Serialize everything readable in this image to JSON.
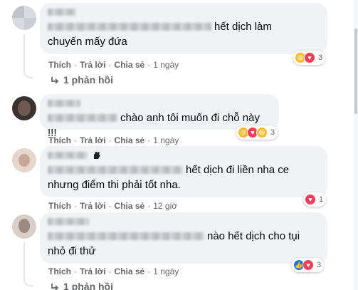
{
  "comments": [
    {
      "text_visible": "hết dịch làm",
      "text_line2": "chuyến mấy đứa",
      "actions": {
        "like": "Thích",
        "reply": "Trả lời",
        "share": "Chia sẻ",
        "time": "1 ngày"
      },
      "reactions": [
        "haha-icon",
        "love-icon"
      ],
      "reaction_count": "3",
      "replies_label": "1 phản hồi"
    },
    {
      "text_visible": "chào anh tôi muốn đi chỗ này !!!",
      "actions": {
        "like": "Thích",
        "reply": "Trả lời",
        "share": "Chia sẻ",
        "time": "1 ngày"
      },
      "reactions": [
        "wow-icon",
        "love-icon",
        "haha-icon"
      ],
      "reaction_count": "3"
    },
    {
      "text_visible": "hết dịch đi liền nha ce",
      "text_line2": "nhưng điểm thi phải tốt nha.",
      "actions": {
        "like": "Thích",
        "reply": "Trả lời",
        "share": "Chia sẻ",
        "time": "12 giờ"
      },
      "reactions": [
        "love-icon"
      ],
      "reaction_count": "1"
    },
    {
      "text_visible": "nào hết dịch cho tụi",
      "text_line2": "nhỏ đi thử",
      "actions": {
        "like": "Thích",
        "reply": "Trả lời",
        "share": "Chia sẻ",
        "time": "1 ngày"
      },
      "reactions": [
        "like-icon",
        "love-icon"
      ],
      "reaction_count": "3",
      "replies_label": "1 phản hồi"
    }
  ],
  "colors": {
    "bubble": "#f0f2f5",
    "meta": "#65676b",
    "love": "#f33e58",
    "like": "#1877f2",
    "haha": "#f7b928"
  }
}
